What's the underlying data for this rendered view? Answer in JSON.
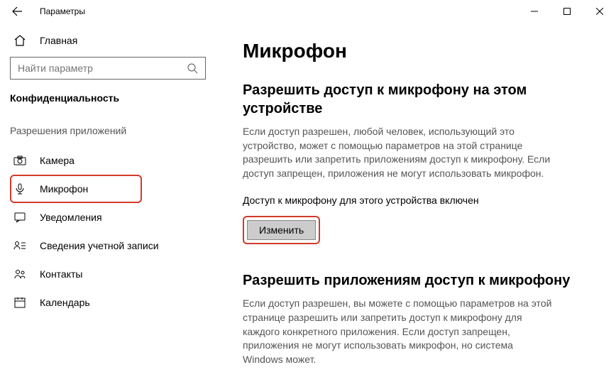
{
  "titlebar": {
    "title": "Параметры"
  },
  "sidebar": {
    "home": "Главная",
    "search_placeholder": "Найти параметр",
    "section": "Конфиденциальность",
    "group": "Разрешения приложений",
    "items": [
      {
        "label": "Камера"
      },
      {
        "label": "Микрофон"
      },
      {
        "label": "Уведомления"
      },
      {
        "label": "Сведения учетной записи"
      },
      {
        "label": "Контакты"
      },
      {
        "label": "Календарь"
      }
    ]
  },
  "content": {
    "heading": "Микрофон",
    "section1_title": "Разрешить доступ к микрофону на этом устройстве",
    "section1_desc": "Если доступ разрешен, любой человек, использующий это устройство, может с помощью параметров на этой странице разрешить или запретить приложениям доступ к микрофону. Если доступ запрещен, приложения не могут использовать микрофон.",
    "status": "Доступ к микрофону для этого устройства включен",
    "change_btn": "Изменить",
    "section2_title": "Разрешить приложениям доступ к микрофону",
    "section2_desc": "Если доступ разрешен, вы можете с помощью параметров на этой странице разрешить или запретить доступ к микрофону для каждого конкретного приложения. Если доступ запрещен, приложения не могут использовать микрофон, но система Windows может."
  }
}
